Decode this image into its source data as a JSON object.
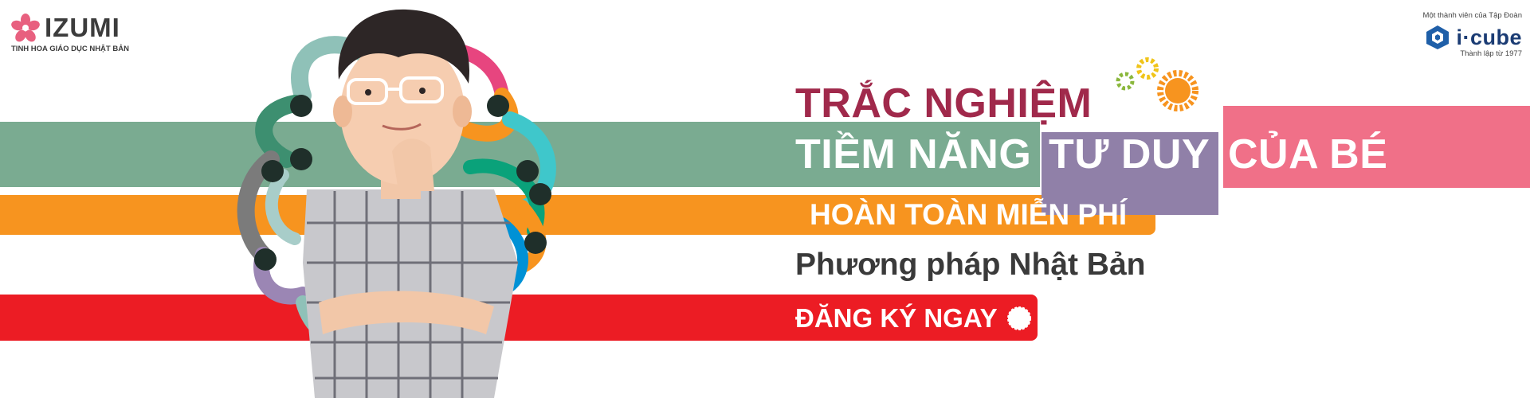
{
  "brand": {
    "name": "IZUMI",
    "tagline": "TINH HOA GIÁO DỤC NHẬT BẢN"
  },
  "partner": {
    "top_text": "Một thành viên của Tập Đoàn",
    "name": "i·cube",
    "sub_text": "Thành lập từ 1977"
  },
  "headline": {
    "line1": "TRẮC NGHIỆM",
    "line2_part1": "TIỀM NĂNG",
    "line2_part2": "TƯ DUY",
    "line2_part3": "CỦA BÉ"
  },
  "offer": "HOÀN TOÀN MIỄN PHÍ",
  "method": "Phương pháp Nhật Bản",
  "cta": {
    "label": "ĐĂNG KÝ NGAY"
  },
  "icons": {
    "logo": "sakura-flower-icon",
    "partner_logo": "cube-icon",
    "gears": "gears-icon",
    "cta": "sun-badge-icon"
  },
  "colors": {
    "green": "#7aab91",
    "orange": "#f7941f",
    "red": "#ec1c24",
    "purple": "#9080a8",
    "pink": "#f07088",
    "maroon": "#a0294b"
  }
}
